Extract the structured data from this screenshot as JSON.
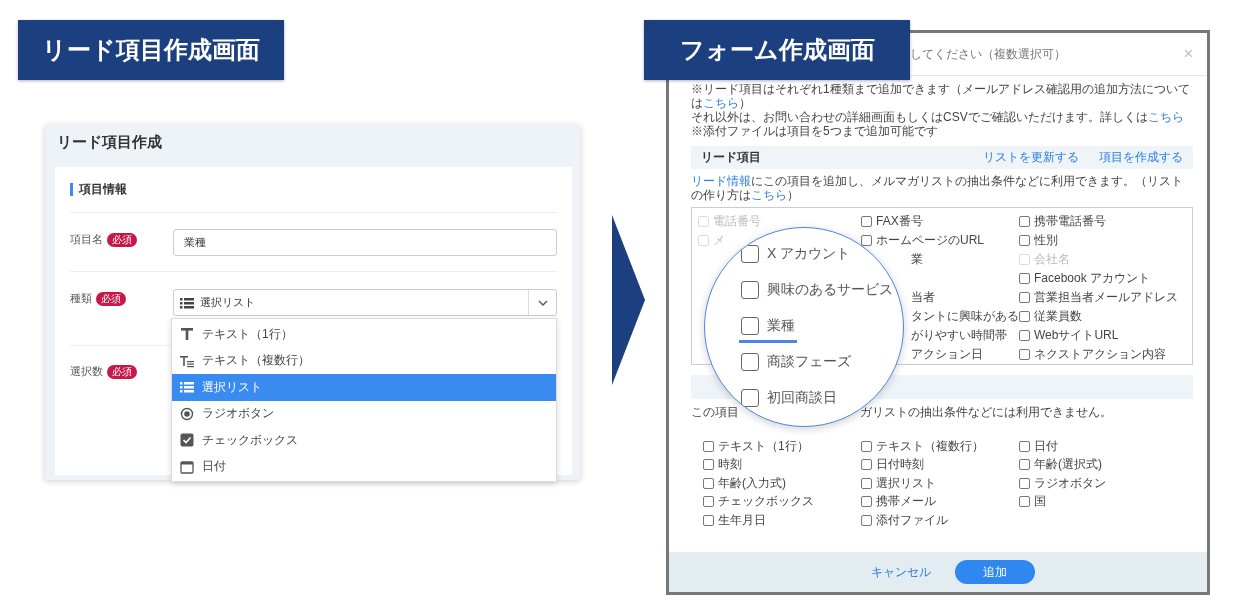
{
  "left": {
    "badge": "リード項目作成画面",
    "title": "リード項目作成",
    "section_title": "項目情報",
    "fields": [
      {
        "label": "項目名",
        "required": "必須",
        "kind": "input",
        "value": "業種"
      },
      {
        "label": "種類",
        "required": "必須",
        "kind": "select",
        "value": "選択リスト"
      },
      {
        "label": "選択数",
        "required": "必須",
        "kind": "empty"
      }
    ],
    "dropdown_options": [
      {
        "kind": "text",
        "label": "テキスト（1行）",
        "selected": false
      },
      {
        "kind": "textarea",
        "label": "テキスト（複数行）",
        "selected": false
      },
      {
        "kind": "list",
        "label": "選択リスト",
        "selected": true
      },
      {
        "kind": "radio",
        "label": "ラジオボタン",
        "selected": false
      },
      {
        "kind": "checkbox",
        "label": "チェックボックス",
        "selected": false
      },
      {
        "kind": "date",
        "label": "日付",
        "selected": false
      }
    ]
  },
  "right": {
    "badge": "フォーム作成画面",
    "modal": {
      "title": "してください（複数選択可）",
      "close": "×",
      "notes": [
        [
          {
            "text": "※リード項目はそれぞれ1種類まで追加できます（メールアドレス確認用の追加方法については"
          },
          {
            "text": "こちら",
            "link": true
          },
          {
            "text": "）"
          }
        ],
        [
          {
            "text": "それ以外は、お問い合わせの詳細画面もしくはCSVでご確認いただけます。詳しくは"
          },
          {
            "text": "こちら",
            "link": true
          }
        ],
        [
          {
            "text": "※添付ファイルは項目を5つまで追加可能です"
          }
        ]
      ],
      "lead_section": {
        "title": "リード項目",
        "actions": [
          "リストを更新する",
          "項目を作成する"
        ],
        "description": [
          {
            "text": "リード情報",
            "link": true
          },
          {
            "text": "にこの項目を追加し、メルマガリストの抽出条件などに利用できます。（リストの作り方は"
          },
          {
            "text": "こちら",
            "link": true
          },
          {
            "text": "）"
          }
        ],
        "columns": [
          [
            {
              "kind": "item",
              "label": "電話番号",
              "checked": false,
              "disabled": true
            },
            {
              "kind": "item",
              "label": "メ",
              "checked": false,
              "disabled": true
            }
          ],
          [
            {
              "kind": "item",
              "label": "FAX番号",
              "checked": false,
              "disabled": false
            },
            {
              "kind": "item",
              "label": "ホームページのURL",
              "checked": false,
              "disabled": false
            },
            {
              "kind": "fragment",
              "label": "業"
            },
            {
              "kind": "covered"
            },
            {
              "kind": "fragment",
              "label": "当者"
            },
            {
              "kind": "fragment",
              "label": "タントに興味がある"
            },
            {
              "kind": "fragment",
              "label": "がりやすい時間帯"
            },
            {
              "kind": "fragment",
              "label": "アクション日"
            }
          ],
          [
            {
              "kind": "item",
              "label": "携帯電話番号",
              "checked": false,
              "disabled": false
            },
            {
              "kind": "item",
              "label": "性別",
              "checked": false,
              "disabled": false
            },
            {
              "kind": "item",
              "label": "会社名",
              "checked": false,
              "disabled": true
            },
            {
              "kind": "item",
              "label": "Facebook アカウント",
              "checked": false,
              "disabled": false
            },
            {
              "kind": "item",
              "label": "営業担当者メールアドレス",
              "checked": false,
              "disabled": false
            },
            {
              "kind": "item",
              "label": "従業員数",
              "checked": false,
              "disabled": false
            },
            {
              "kind": "item",
              "label": "WebサイトURL",
              "checked": false,
              "disabled": false
            },
            {
              "kind": "item",
              "label": "ネクストアクション内容",
              "checked": false,
              "disabled": false
            }
          ]
        ]
      },
      "other_section": {
        "description_parts": [
          "この項目",
          "ガリストの抽出条件などには利用できません。"
        ],
        "columns": [
          [
            {
              "kind": "item",
              "label": "テキスト（1行）",
              "checked": false,
              "disabled": false
            },
            {
              "kind": "item",
              "label": "時刻",
              "checked": false,
              "disabled": false
            },
            {
              "kind": "item",
              "label": "年齢(入力式)",
              "checked": false,
              "disabled": false
            },
            {
              "kind": "item",
              "label": "チェックボックス",
              "checked": false,
              "disabled": false
            },
            {
              "kind": "item",
              "label": "生年月日",
              "checked": false,
              "disabled": false
            }
          ],
          [
            {
              "kind": "item",
              "label": "テキスト（複数行）",
              "checked": false,
              "disabled": false
            },
            {
              "kind": "item",
              "label": "日付時刻",
              "checked": false,
              "disabled": false
            },
            {
              "kind": "item",
              "label": "選択リスト",
              "checked": false,
              "disabled": false
            },
            {
              "kind": "item",
              "label": "携帯メール",
              "checked": false,
              "disabled": false
            },
            {
              "kind": "item",
              "label": "添付ファイル",
              "checked": false,
              "disabled": false
            }
          ],
          [
            {
              "kind": "item",
              "label": "日付",
              "checked": false,
              "disabled": false
            },
            {
              "kind": "item",
              "label": "年齢(選択式)",
              "checked": false,
              "disabled": false
            },
            {
              "kind": "item",
              "label": "ラジオボタン",
              "checked": false,
              "disabled": false
            },
            {
              "kind": "item",
              "label": "国",
              "checked": false,
              "disabled": false
            }
          ]
        ]
      },
      "footer": {
        "cancel": "キャンセル",
        "submit": "追加"
      }
    }
  },
  "magnifier": {
    "items": [
      {
        "label": "X アカウント",
        "checked": false,
        "highlighted": false
      },
      {
        "label": "興味のあるサービス",
        "checked": false,
        "highlighted": false
      },
      {
        "label": "業種",
        "checked": false,
        "highlighted": true
      },
      {
        "label": "商談フェーズ",
        "checked": false,
        "highlighted": false
      },
      {
        "label": "初回商談日",
        "checked": false,
        "highlighted": false
      }
    ]
  }
}
